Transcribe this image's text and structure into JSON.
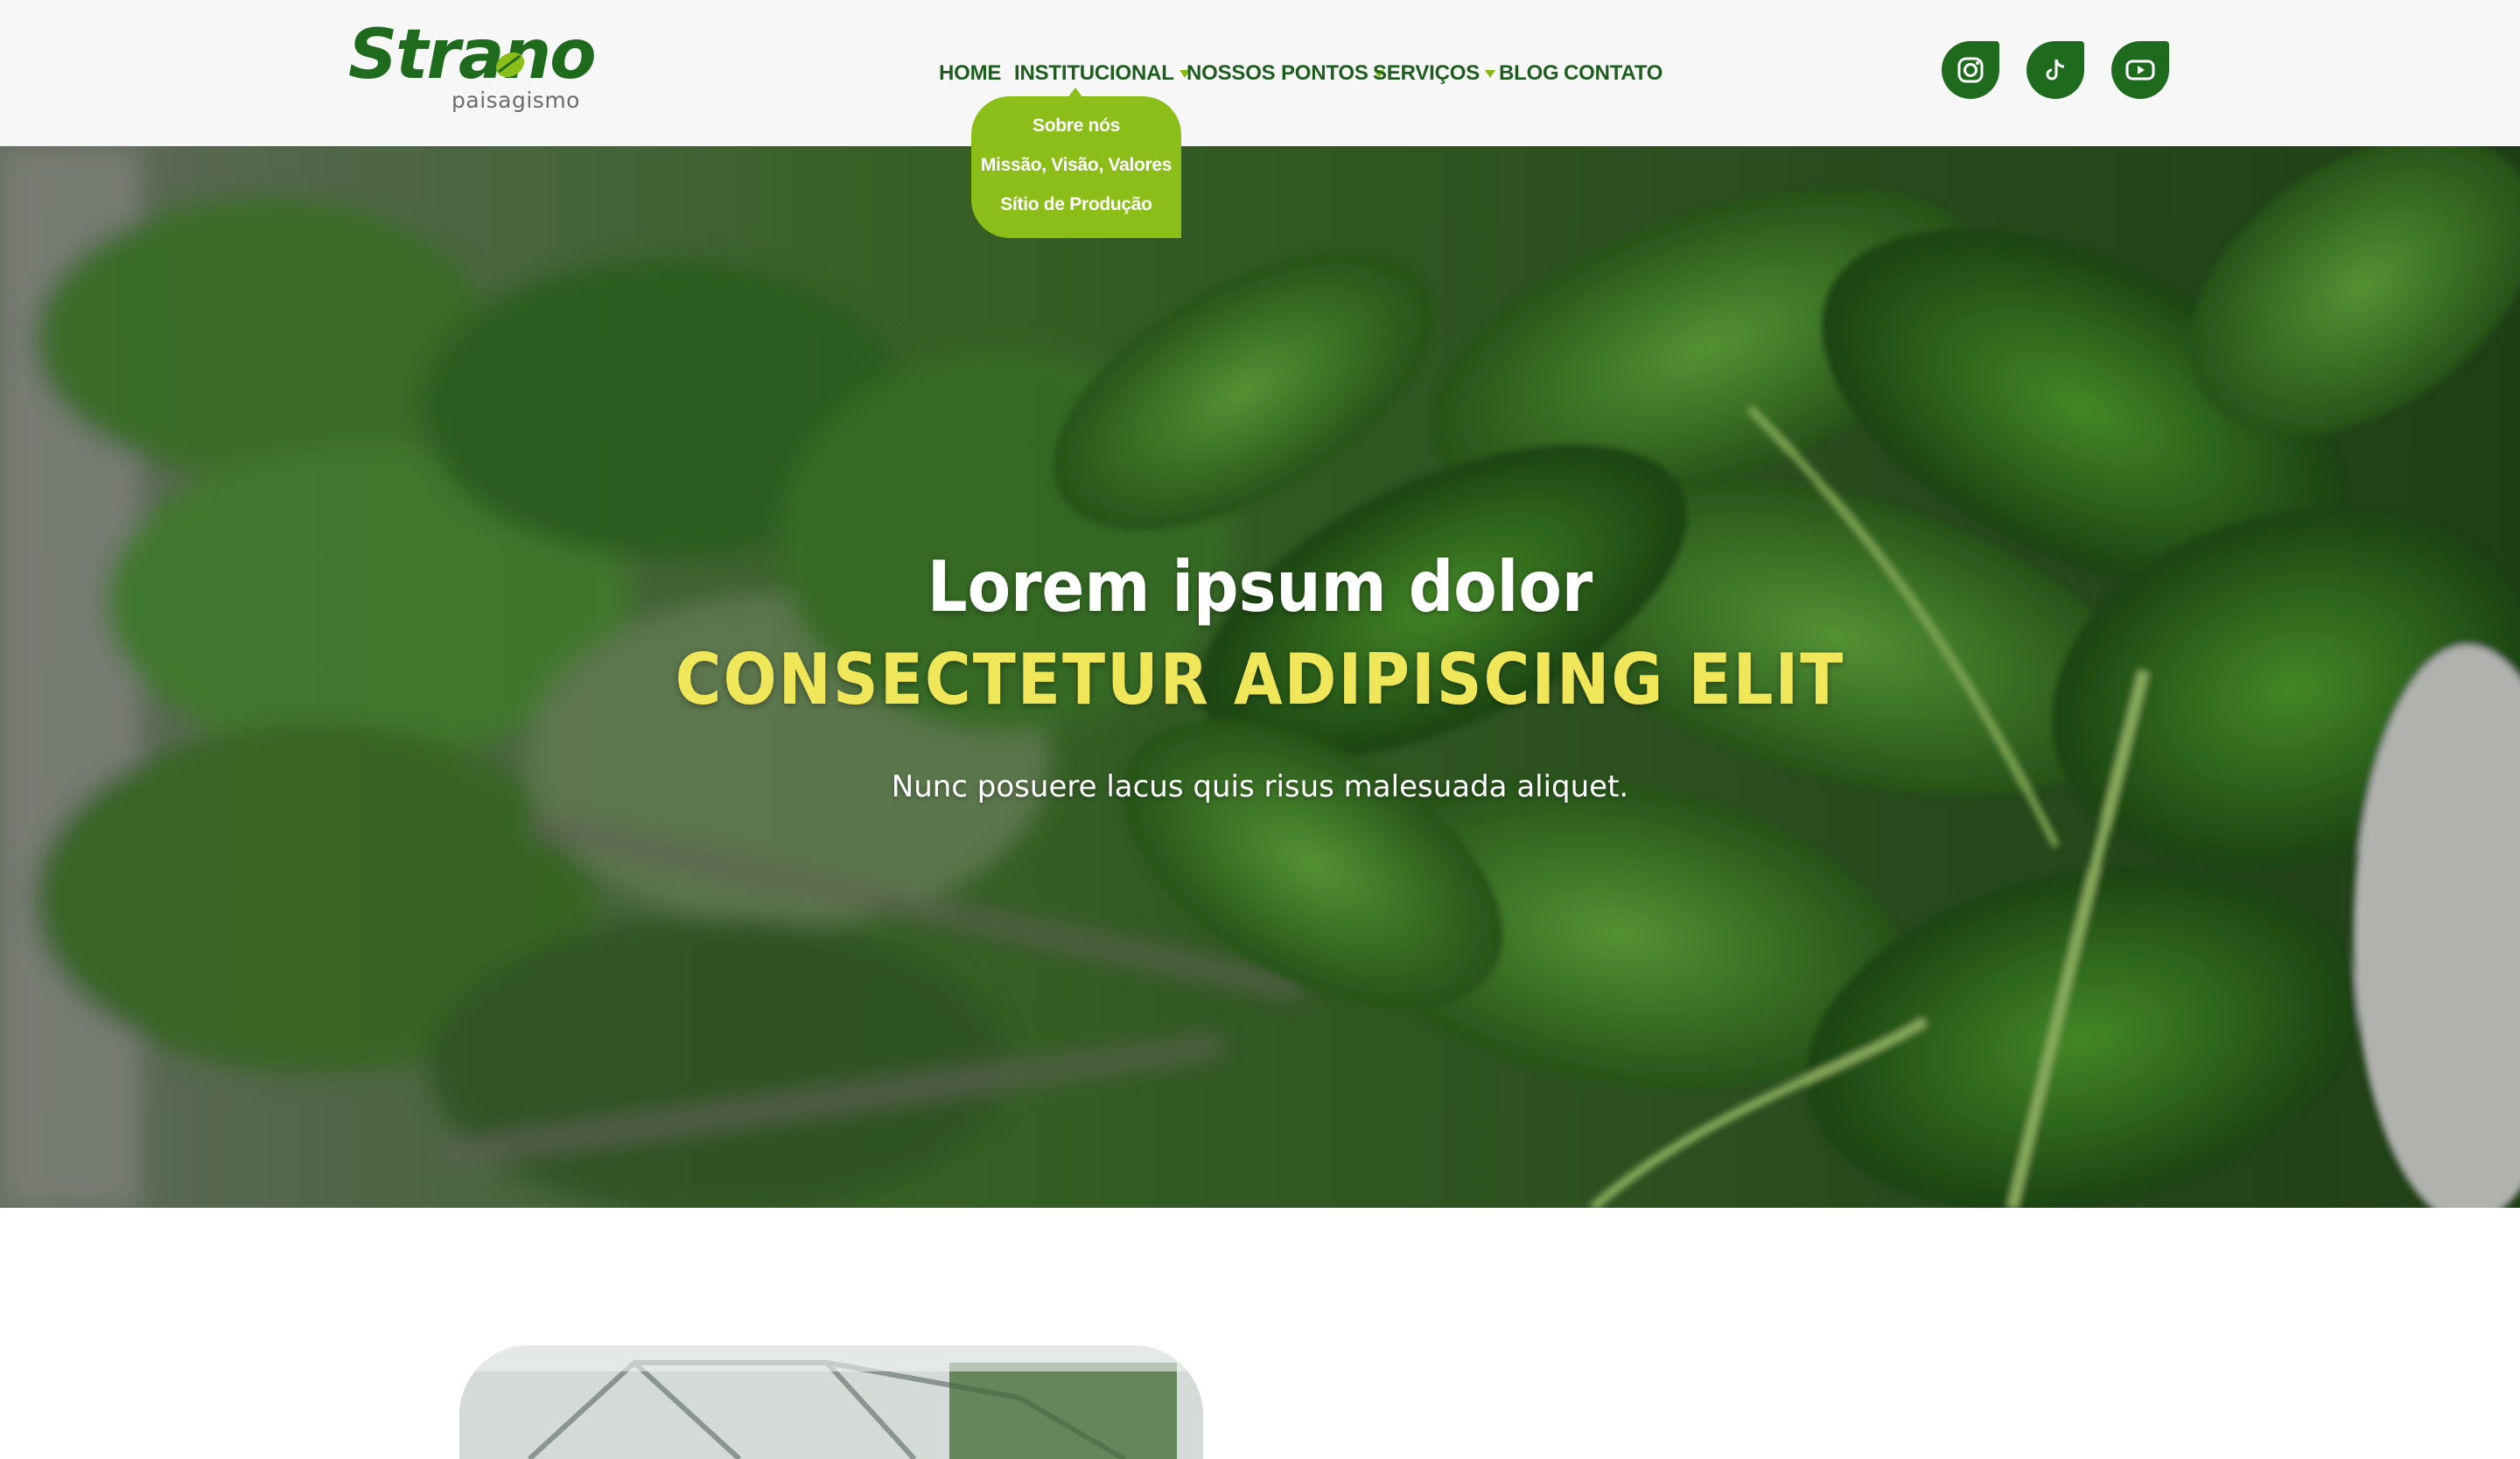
{
  "brand": {
    "name": "Strano",
    "tagline": "paisagismo",
    "logo_icon": "leaf-icon"
  },
  "colors": {
    "brand_green": "#1e6b1e",
    "accent_green": "#8cbe1a",
    "accent_yellow": "#f0e65a",
    "nav_text": "#1f5c1f"
  },
  "nav": {
    "home": "HOME",
    "institucional": "INSTITUCIONAL",
    "nossos_pontos": "NOSSOS PONTOS",
    "servicos": "SERVIÇOS",
    "blog": "BLOG",
    "contato": "CONTATO"
  },
  "dropdown": {
    "items": [
      "Sobre nós",
      "Missão, Visão, Valores",
      "Sítio de Produção"
    ]
  },
  "social": {
    "instagram": "instagram-icon",
    "tiktok": "tiktok-icon",
    "youtube": "youtube-icon"
  },
  "hero": {
    "title": "Lorem ipsum dolor",
    "subtitle": "CONSECTETUR ADIPISCING ELIT",
    "text": "Nunc posuere lacus quis risus malesuada aliquet."
  }
}
